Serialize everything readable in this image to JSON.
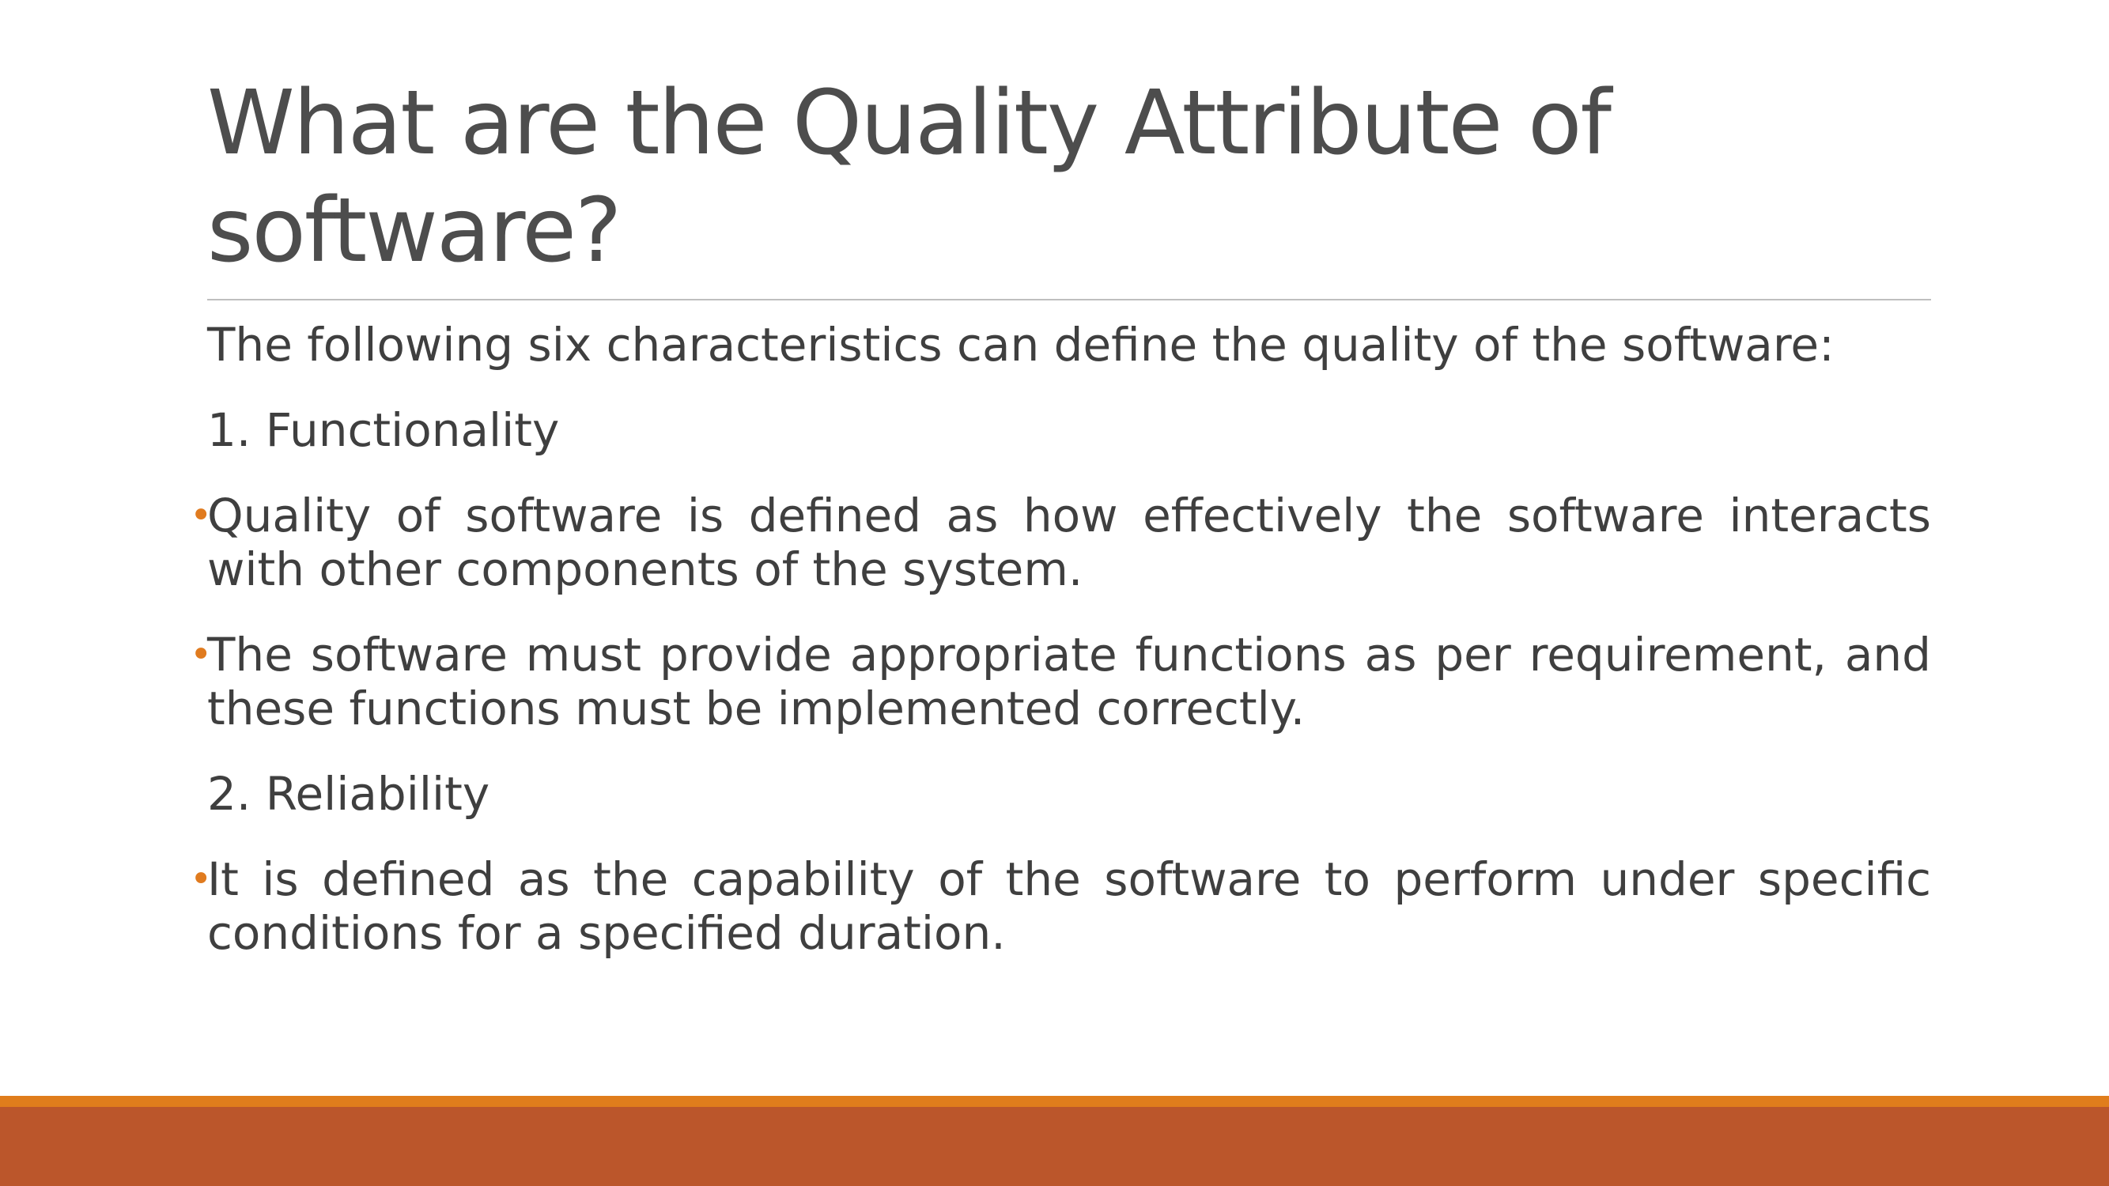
{
  "slide": {
    "title": "What are the Quality Attribute of software?",
    "intro": "The following six characteristics can define the quality of the software:",
    "sections": [
      {
        "heading": "1. Functionality",
        "bullets": [
          "Quality of software is defined as how effectively the software interacts with other components of the system.",
          "The software must provide appropriate functions as per requirement, and these functions must be implemented correctly."
        ]
      },
      {
        "heading": "2. Reliability",
        "bullets": [
          "It is defined as the capability of the software to perform under specific conditions for a specified duration."
        ]
      }
    ]
  },
  "theme": {
    "accent": "#e07d1c",
    "band": "#bb562b",
    "bullet_color": "#e07b1f",
    "text_color": "#404040"
  }
}
